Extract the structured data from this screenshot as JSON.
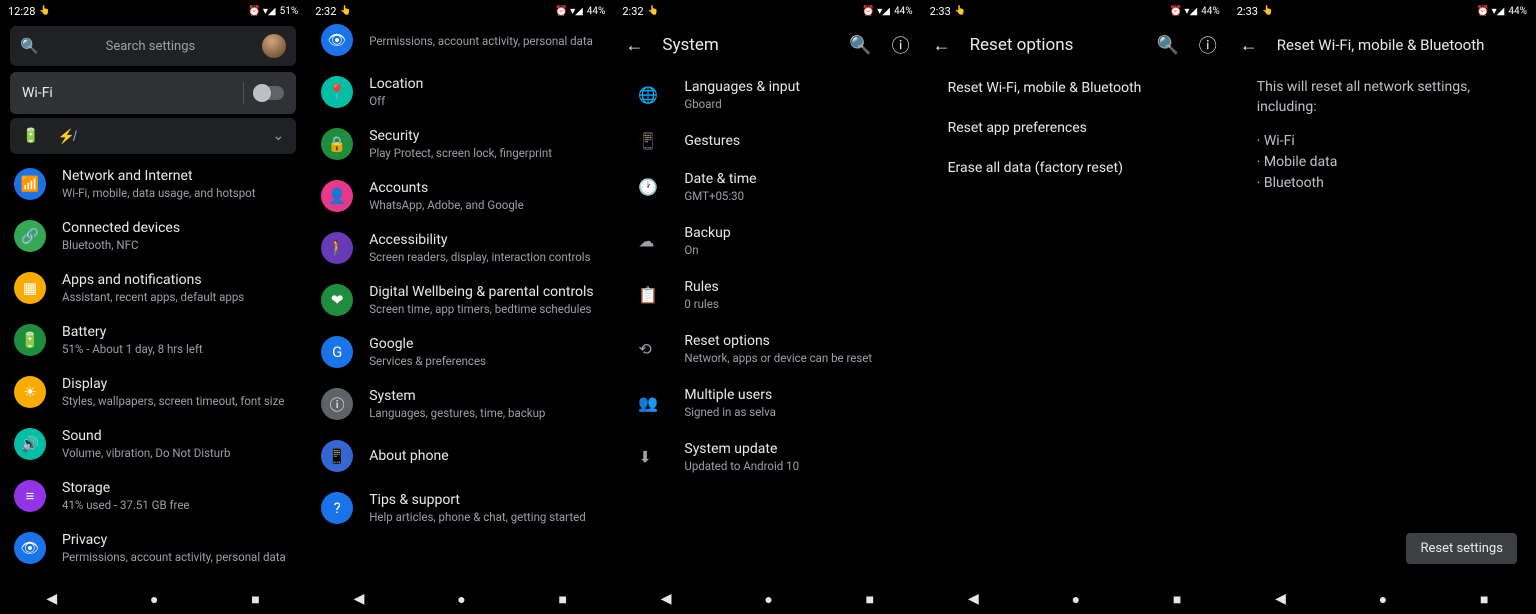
{
  "screens": [
    {
      "status": {
        "time": "12:28",
        "battery": "51%",
        "indicators": "⏰ ▾◢ 🔋"
      },
      "search": {
        "placeholder": "Search settings"
      },
      "wifi_chip": {
        "label": "Wi-Fi"
      },
      "items": [
        {
          "icon": "📶",
          "bg": "#1a73e8",
          "title": "Network and Internet",
          "sub": "Wi-Fi, mobile, data usage, and hotspot"
        },
        {
          "icon": "🔗",
          "bg": "#34a853",
          "title": "Connected devices",
          "sub": "Bluetooth, NFC"
        },
        {
          "icon": "▦",
          "bg": "#f9ab00",
          "title": "Apps and notifications",
          "sub": "Assistant, recent apps, default apps"
        },
        {
          "icon": "🔋",
          "bg": "#1e8e3e",
          "title": "Battery",
          "sub": "51% - About 1 day, 8 hrs left"
        },
        {
          "icon": "☀",
          "bg": "#f9ab00",
          "title": "Display",
          "sub": "Styles, wallpapers, screen timeout, font size"
        },
        {
          "icon": "🔊",
          "bg": "#00bfa5",
          "title": "Sound",
          "sub": "Volume, vibration, Do Not Disturb"
        },
        {
          "icon": "≡",
          "bg": "#9334e6",
          "title": "Storage",
          "sub": "41% used - 37.51 GB free"
        },
        {
          "icon": "👁",
          "bg": "#1a73e8",
          "title": "Privacy",
          "sub": "Permissions, account activity, personal data"
        }
      ]
    },
    {
      "status": {
        "time": "2:32",
        "battery": "44%",
        "indicators": "⏰ ▾◢ 🔋"
      },
      "partial": {
        "sub": "Permissions, account activity, personal data"
      },
      "items": [
        {
          "icon": "📍",
          "bg": "#00bfa5",
          "title": "Location",
          "sub": "Off"
        },
        {
          "icon": "🔒",
          "bg": "#1e8e3e",
          "title": "Security",
          "sub": "Play Protect, screen lock, fingerprint"
        },
        {
          "icon": "👤",
          "bg": "#e8388c",
          "title": "Accounts",
          "sub": "WhatsApp, Adobe, and Google"
        },
        {
          "icon": "🚶",
          "bg": "#673ab7",
          "title": "Accessibility",
          "sub": "Screen readers, display, interaction controls"
        },
        {
          "icon": "❤",
          "bg": "#1e8e3e",
          "title": "Digital Wellbeing & parental controls",
          "sub": "Screen time, app timers, bedtime schedules"
        },
        {
          "icon": "G",
          "bg": "#1a73e8",
          "title": "Google",
          "sub": "Services & preferences"
        },
        {
          "icon": "ⓘ",
          "bg": "#5f6368",
          "title": "System",
          "sub": "Languages, gestures, time, backup"
        },
        {
          "icon": "📱",
          "bg": "#3367d6",
          "title": "About phone",
          "sub": ""
        },
        {
          "icon": "?",
          "bg": "#1a73e8",
          "title": "Tips & support",
          "sub": "Help articles, phone & chat, getting started"
        }
      ]
    },
    {
      "status": {
        "time": "2:32",
        "battery": "44%",
        "indicators": "⏰ ▾◢ 🔋"
      },
      "title": "System",
      "items": [
        {
          "icon": "🌐",
          "title": "Languages & input",
          "sub": "Gboard"
        },
        {
          "icon": "📱",
          "title": "Gestures",
          "sub": ""
        },
        {
          "icon": "🕐",
          "title": "Date & time",
          "sub": "GMT+05:30"
        },
        {
          "icon": "☁",
          "title": "Backup",
          "sub": "On"
        },
        {
          "icon": "📋",
          "title": "Rules",
          "sub": "0 rules"
        },
        {
          "icon": "⟲",
          "title": "Reset options",
          "sub": "Network, apps or device can be reset"
        },
        {
          "icon": "👥",
          "title": "Multiple users",
          "sub": "Signed in as selva"
        },
        {
          "icon": "⬇",
          "title": "System update",
          "sub": "Updated to Android 10"
        }
      ]
    },
    {
      "status": {
        "time": "2:33",
        "battery": "44%",
        "indicators": "⏰ ▾◢ 🔋"
      },
      "title": "Reset options",
      "items": [
        {
          "title": "Reset Wi-Fi, mobile & Bluetooth"
        },
        {
          "title": "Reset app preferences"
        },
        {
          "title": "Erase all data (factory reset)"
        }
      ]
    },
    {
      "status": {
        "time": "2:33",
        "battery": "44%",
        "indicators": "⏰ ▾◢ 🔋"
      },
      "title": "Reset Wi-Fi, mobile & Bluetooth",
      "para": "This will reset all network settings, including:",
      "bullets": [
        "Wi-Fi",
        "Mobile data",
        "Bluetooth"
      ],
      "button": "Reset settings"
    }
  ]
}
